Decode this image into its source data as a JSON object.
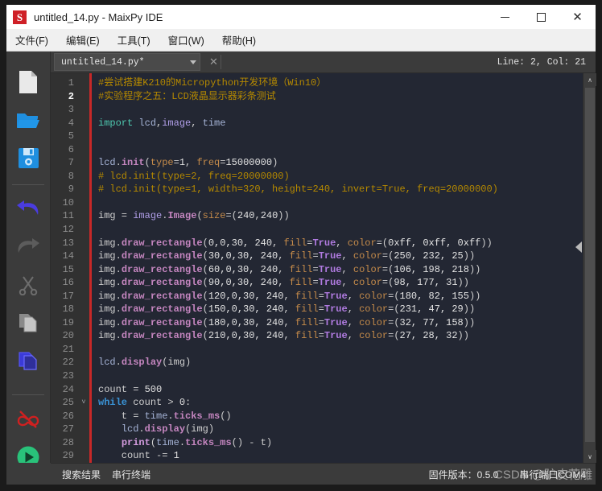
{
  "window": {
    "icon_name": "maixpy-logo-icon",
    "icon_letter": "S",
    "title": "untitled_14.py - MaixPy IDE",
    "minimize_label": "–",
    "maximize_label": "",
    "close_label": "✕"
  },
  "menu": {
    "items": [
      {
        "label": "文件(F)"
      },
      {
        "label": "编辑(E)"
      },
      {
        "label": "工具(T)"
      },
      {
        "label": "窗口(W)"
      },
      {
        "label": "帮助(H)"
      }
    ]
  },
  "toolbar": {
    "items": [
      {
        "name": "new-file-icon",
        "title": "New File"
      },
      {
        "name": "open-folder-icon",
        "title": "Open File"
      },
      {
        "name": "save-icon",
        "title": "Save"
      },
      {
        "name": "undo-icon",
        "title": "Undo"
      },
      {
        "name": "redo-icon",
        "title": "Redo"
      },
      {
        "name": "cut-icon",
        "title": "Cut"
      },
      {
        "name": "copy-icon",
        "title": "Copy"
      },
      {
        "name": "paste-icon",
        "title": "Paste"
      },
      {
        "name": "disconnect-icon",
        "title": "Disconnect"
      },
      {
        "name": "run-icon",
        "title": "Run"
      }
    ]
  },
  "tab": {
    "label": "untitled_14.py*",
    "close_label": "✕",
    "status": "Line: 2, Col: 21"
  },
  "editor": {
    "current_line": 2,
    "fold_line": 25,
    "fold_glyph": "˅",
    "lines": [
      {
        "n": 1,
        "tokens": [
          {
            "c": "t-cmt",
            "t": "#尝试搭建K210的Micropython开发环境（Win10）"
          }
        ]
      },
      {
        "n": 2,
        "tokens": [
          {
            "c": "t-cmt",
            "t": "#实验程序之五：LCD液晶显示器彩条测试"
          }
        ]
      },
      {
        "n": 3,
        "tokens": []
      },
      {
        "n": 4,
        "tokens": [
          {
            "c": "t-imp",
            "t": "import"
          },
          {
            "c": "t-plain",
            "t": " "
          },
          {
            "c": "t-obj",
            "t": "lcd"
          },
          {
            "c": "t-plain",
            "t": ","
          },
          {
            "c": "t-mod",
            "t": "image"
          },
          {
            "c": "t-plain",
            "t": ", "
          },
          {
            "c": "t-obj",
            "t": "time"
          }
        ]
      },
      {
        "n": 5,
        "tokens": []
      },
      {
        "n": 6,
        "tokens": []
      },
      {
        "n": 7,
        "tokens": [
          {
            "c": "t-obj",
            "t": "lcd"
          },
          {
            "c": "t-plain",
            "t": "."
          },
          {
            "c": "t-fn",
            "t": "init"
          },
          {
            "c": "t-plain",
            "t": "("
          },
          {
            "c": "t-attr",
            "t": "type"
          },
          {
            "c": "t-plain",
            "t": "="
          },
          {
            "c": "t-num",
            "t": "1"
          },
          {
            "c": "t-plain",
            "t": ", "
          },
          {
            "c": "t-attr",
            "t": "freq"
          },
          {
            "c": "t-plain",
            "t": "="
          },
          {
            "c": "t-num",
            "t": "15000000"
          },
          {
            "c": "t-plain",
            "t": ")"
          }
        ]
      },
      {
        "n": 8,
        "tokens": [
          {
            "c": "t-cmt",
            "t": "# lcd.init(type=2, freq=20000000)"
          }
        ]
      },
      {
        "n": 9,
        "tokens": [
          {
            "c": "t-cmt",
            "t": "# lcd.init(type=1, width=320, height=240, invert=True, freq=20000000)"
          }
        ]
      },
      {
        "n": 10,
        "tokens": []
      },
      {
        "n": 11,
        "tokens": [
          {
            "c": "t-plain",
            "t": "img = "
          },
          {
            "c": "t-mod",
            "t": "image"
          },
          {
            "c": "t-plain",
            "t": "."
          },
          {
            "c": "t-fn",
            "t": "Image"
          },
          {
            "c": "t-plain",
            "t": "("
          },
          {
            "c": "t-attr",
            "t": "size"
          },
          {
            "c": "t-plain",
            "t": "=("
          },
          {
            "c": "t-num",
            "t": "240"
          },
          {
            "c": "t-plain",
            "t": ","
          },
          {
            "c": "t-num",
            "t": "240"
          },
          {
            "c": "t-plain",
            "t": "))"
          }
        ]
      },
      {
        "n": 12,
        "tokens": []
      },
      {
        "n": 13,
        "tokens": [
          {
            "c": "t-plain",
            "t": "img."
          },
          {
            "c": "t-fn",
            "t": "draw_rectangle"
          },
          {
            "c": "t-plain",
            "t": "("
          },
          {
            "c": "t-num",
            "t": "0,0,30, 240"
          },
          {
            "c": "t-plain",
            "t": ", "
          },
          {
            "c": "t-attr",
            "t": "fill"
          },
          {
            "c": "t-plain",
            "t": "="
          },
          {
            "c": "t-const",
            "t": "True"
          },
          {
            "c": "t-plain",
            "t": ", "
          },
          {
            "c": "t-attr",
            "t": "color"
          },
          {
            "c": "t-plain",
            "t": "=("
          },
          {
            "c": "t-num",
            "t": "0xff, 0xff, 0xff"
          },
          {
            "c": "t-plain",
            "t": "))"
          }
        ]
      },
      {
        "n": 14,
        "tokens": [
          {
            "c": "t-plain",
            "t": "img."
          },
          {
            "c": "t-fn",
            "t": "draw_rectangle"
          },
          {
            "c": "t-plain",
            "t": "("
          },
          {
            "c": "t-num",
            "t": "30,0,30, 240"
          },
          {
            "c": "t-plain",
            "t": ", "
          },
          {
            "c": "t-attr",
            "t": "fill"
          },
          {
            "c": "t-plain",
            "t": "="
          },
          {
            "c": "t-const",
            "t": "True"
          },
          {
            "c": "t-plain",
            "t": ", "
          },
          {
            "c": "t-attr",
            "t": "color"
          },
          {
            "c": "t-plain",
            "t": "=("
          },
          {
            "c": "t-num",
            "t": "250, 232, 25"
          },
          {
            "c": "t-plain",
            "t": "))"
          }
        ]
      },
      {
        "n": 15,
        "tokens": [
          {
            "c": "t-plain",
            "t": "img."
          },
          {
            "c": "t-fn",
            "t": "draw_rectangle"
          },
          {
            "c": "t-plain",
            "t": "("
          },
          {
            "c": "t-num",
            "t": "60,0,30, 240"
          },
          {
            "c": "t-plain",
            "t": ", "
          },
          {
            "c": "t-attr",
            "t": "fill"
          },
          {
            "c": "t-plain",
            "t": "="
          },
          {
            "c": "t-const",
            "t": "True"
          },
          {
            "c": "t-plain",
            "t": ", "
          },
          {
            "c": "t-attr",
            "t": "color"
          },
          {
            "c": "t-plain",
            "t": "=("
          },
          {
            "c": "t-num",
            "t": "106, 198, 218"
          },
          {
            "c": "t-plain",
            "t": "))"
          }
        ]
      },
      {
        "n": 16,
        "tokens": [
          {
            "c": "t-plain",
            "t": "img."
          },
          {
            "c": "t-fn",
            "t": "draw_rectangle"
          },
          {
            "c": "t-plain",
            "t": "("
          },
          {
            "c": "t-num",
            "t": "90,0,30, 240"
          },
          {
            "c": "t-plain",
            "t": ", "
          },
          {
            "c": "t-attr",
            "t": "fill"
          },
          {
            "c": "t-plain",
            "t": "="
          },
          {
            "c": "t-const",
            "t": "True"
          },
          {
            "c": "t-plain",
            "t": ", "
          },
          {
            "c": "t-attr",
            "t": "color"
          },
          {
            "c": "t-plain",
            "t": "=("
          },
          {
            "c": "t-num",
            "t": "98, 177, 31"
          },
          {
            "c": "t-plain",
            "t": "))"
          }
        ]
      },
      {
        "n": 17,
        "tokens": [
          {
            "c": "t-plain",
            "t": "img."
          },
          {
            "c": "t-fn",
            "t": "draw_rectangle"
          },
          {
            "c": "t-plain",
            "t": "("
          },
          {
            "c": "t-num",
            "t": "120,0,30, 240"
          },
          {
            "c": "t-plain",
            "t": ", "
          },
          {
            "c": "t-attr",
            "t": "fill"
          },
          {
            "c": "t-plain",
            "t": "="
          },
          {
            "c": "t-const",
            "t": "True"
          },
          {
            "c": "t-plain",
            "t": ", "
          },
          {
            "c": "t-attr",
            "t": "color"
          },
          {
            "c": "t-plain",
            "t": "=("
          },
          {
            "c": "t-num",
            "t": "180, 82, 155"
          },
          {
            "c": "t-plain",
            "t": "))"
          }
        ]
      },
      {
        "n": 18,
        "tokens": [
          {
            "c": "t-plain",
            "t": "img."
          },
          {
            "c": "t-fn",
            "t": "draw_rectangle"
          },
          {
            "c": "t-plain",
            "t": "("
          },
          {
            "c": "t-num",
            "t": "150,0,30, 240"
          },
          {
            "c": "t-plain",
            "t": ", "
          },
          {
            "c": "t-attr",
            "t": "fill"
          },
          {
            "c": "t-plain",
            "t": "="
          },
          {
            "c": "t-const",
            "t": "True"
          },
          {
            "c": "t-plain",
            "t": ", "
          },
          {
            "c": "t-attr",
            "t": "color"
          },
          {
            "c": "t-plain",
            "t": "=("
          },
          {
            "c": "t-num",
            "t": "231, 47, 29"
          },
          {
            "c": "t-plain",
            "t": "))"
          }
        ]
      },
      {
        "n": 19,
        "tokens": [
          {
            "c": "t-plain",
            "t": "img."
          },
          {
            "c": "t-fn",
            "t": "draw_rectangle"
          },
          {
            "c": "t-plain",
            "t": "("
          },
          {
            "c": "t-num",
            "t": "180,0,30, 240"
          },
          {
            "c": "t-plain",
            "t": ", "
          },
          {
            "c": "t-attr",
            "t": "fill"
          },
          {
            "c": "t-plain",
            "t": "="
          },
          {
            "c": "t-const",
            "t": "True"
          },
          {
            "c": "t-plain",
            "t": ", "
          },
          {
            "c": "t-attr",
            "t": "color"
          },
          {
            "c": "t-plain",
            "t": "=("
          },
          {
            "c": "t-num",
            "t": "32, 77, 158"
          },
          {
            "c": "t-plain",
            "t": "))"
          }
        ]
      },
      {
        "n": 20,
        "tokens": [
          {
            "c": "t-plain",
            "t": "img."
          },
          {
            "c": "t-fn",
            "t": "draw_rectangle"
          },
          {
            "c": "t-plain",
            "t": "("
          },
          {
            "c": "t-num",
            "t": "210,0,30, 240"
          },
          {
            "c": "t-plain",
            "t": ", "
          },
          {
            "c": "t-attr",
            "t": "fill"
          },
          {
            "c": "t-plain",
            "t": "="
          },
          {
            "c": "t-const",
            "t": "True"
          },
          {
            "c": "t-plain",
            "t": ", "
          },
          {
            "c": "t-attr",
            "t": "color"
          },
          {
            "c": "t-plain",
            "t": "=("
          },
          {
            "c": "t-num",
            "t": "27, 28, 32"
          },
          {
            "c": "t-plain",
            "t": "))"
          }
        ]
      },
      {
        "n": 21,
        "tokens": []
      },
      {
        "n": 22,
        "tokens": [
          {
            "c": "t-obj",
            "t": "lcd"
          },
          {
            "c": "t-plain",
            "t": "."
          },
          {
            "c": "t-fn",
            "t": "display"
          },
          {
            "c": "t-plain",
            "t": "(img)"
          }
        ]
      },
      {
        "n": 23,
        "tokens": []
      },
      {
        "n": 24,
        "tokens": [
          {
            "c": "t-plain",
            "t": "count = "
          },
          {
            "c": "t-num",
            "t": "500"
          }
        ]
      },
      {
        "n": 25,
        "tokens": [
          {
            "c": "t-kw",
            "t": "while"
          },
          {
            "c": "t-plain",
            "t": " count > "
          },
          {
            "c": "t-num",
            "t": "0"
          },
          {
            "c": "t-plain",
            "t": ":"
          }
        ]
      },
      {
        "n": 26,
        "tokens": [
          {
            "c": "t-plain",
            "t": "    t = "
          },
          {
            "c": "t-obj",
            "t": "time"
          },
          {
            "c": "t-plain",
            "t": "."
          },
          {
            "c": "t-fn",
            "t": "ticks_ms"
          },
          {
            "c": "t-plain",
            "t": "()"
          }
        ]
      },
      {
        "n": 27,
        "tokens": [
          {
            "c": "t-plain",
            "t": "    "
          },
          {
            "c": "t-obj",
            "t": "lcd"
          },
          {
            "c": "t-plain",
            "t": "."
          },
          {
            "c": "t-fn",
            "t": "display"
          },
          {
            "c": "t-plain",
            "t": "(img)"
          }
        ]
      },
      {
        "n": 28,
        "tokens": [
          {
            "c": "t-plain",
            "t": "    "
          },
          {
            "c": "t-bi",
            "t": "print"
          },
          {
            "c": "t-plain",
            "t": "("
          },
          {
            "c": "t-obj",
            "t": "time"
          },
          {
            "c": "t-plain",
            "t": "."
          },
          {
            "c": "t-fn",
            "t": "ticks_ms"
          },
          {
            "c": "t-plain",
            "t": "() - t)"
          }
        ]
      },
      {
        "n": 29,
        "tokens": [
          {
            "c": "t-plain",
            "t": "    count -= "
          },
          {
            "c": "t-num",
            "t": "1"
          }
        ]
      }
    ]
  },
  "scrollbar": {
    "up_glyph": "∧",
    "down_glyph": "∨",
    "collapse_name": "collapse-panel-handle"
  },
  "statusbar": {
    "tabs": [
      {
        "label": "搜索结果"
      },
      {
        "label": "串行终端"
      }
    ],
    "firmware": "固件版本：0.5.0",
    "serial_port": "串行端口COM4",
    "watermark": "CSDN @驴皮花雕"
  },
  "colors": {
    "accent_blue": "#1f8fe0",
    "run_green": "#29c27a",
    "disconnect_red": "#d02020",
    "marker_red": "#c62828",
    "editor_bg": "#232733",
    "chrome_bg": "#3b3b3b"
  }
}
